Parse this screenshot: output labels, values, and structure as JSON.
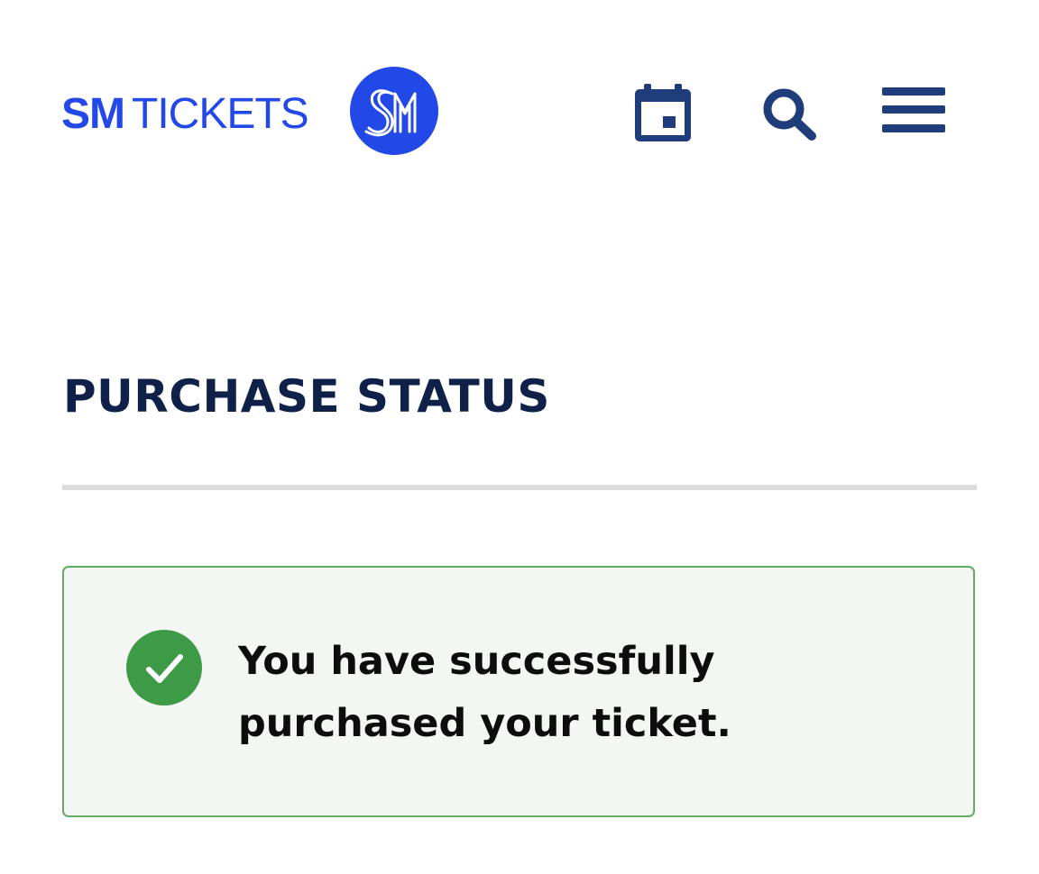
{
  "header": {
    "brand": {
      "sm": "SM",
      "tickets": "TICKETS",
      "logo_letters": "SM"
    },
    "icons": {
      "calendar": "calendar-icon",
      "search": "search-icon",
      "menu": "hamburger-menu-icon"
    }
  },
  "main": {
    "title": "PURCHASE STATUS",
    "alert": {
      "status": "success",
      "icon": "check-circle-icon",
      "message": "You have successfully purchased your ticket."
    }
  },
  "colors": {
    "brand_blue": "#2348e8",
    "icon_navy": "#1e3d7a",
    "title_navy": "#0f2149",
    "success_green": "#3d9b47",
    "alert_background": "#f3f6f3",
    "alert_border": "#5fae62",
    "divider": "#dcdcdc"
  }
}
